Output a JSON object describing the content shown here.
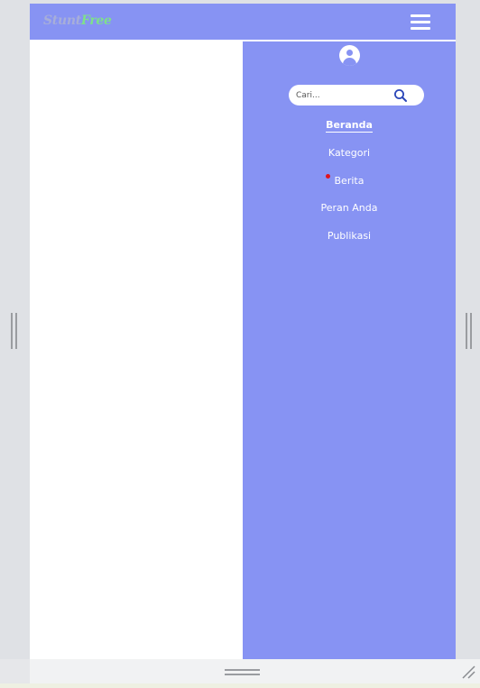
{
  "app": {
    "logo_part1": "Stunt",
    "logo_part2": "Free"
  },
  "search": {
    "placeholder": "Cari..."
  },
  "menu": {
    "items": [
      {
        "label": "Beranda",
        "active": true
      },
      {
        "label": "Kategori",
        "active": false
      },
      {
        "label": "Berita",
        "active": false
      },
      {
        "label": "Peran Anda",
        "active": false
      },
      {
        "label": "Publikasi",
        "active": false
      }
    ]
  },
  "icons": {
    "menu": "hamburger-icon",
    "profile": "user-circle-icon",
    "search": "search-icon",
    "resize": "resize-handle-icon"
  },
  "colors": {
    "navbar": "#8793f3",
    "sidebar": "#8793f3",
    "logo_stunt": "#a7aed9",
    "logo_free": "#7fe08b",
    "search_icon": "#2b47b8",
    "notification_dot": "#e0141e"
  }
}
